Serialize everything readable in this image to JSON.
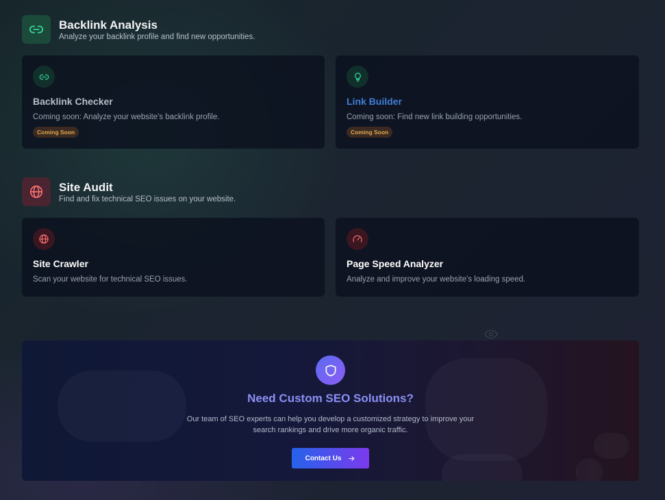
{
  "sections": [
    {
      "title": "Backlink Analysis",
      "subtitle": "Analyze your backlink profile and find new opportunities.",
      "icon": "link-icon",
      "cards": [
        {
          "title": "Backlink Checker",
          "description": "Coming soon: Analyze your website's backlink profile.",
          "badge": "Coming Soon",
          "icon": "link-icon"
        },
        {
          "title": "Link Builder",
          "description": "Coming soon: Find new link building opportunities.",
          "badge": "Coming Soon",
          "icon": "lightbulb-icon"
        }
      ]
    },
    {
      "title": "Site Audit",
      "subtitle": "Find and fix technical SEO issues on your website.",
      "icon": "globe-icon",
      "cards": [
        {
          "title": "Site Crawler",
          "description": "Scan your website for technical SEO issues.",
          "icon": "globe-icon"
        },
        {
          "title": "Page Speed Analyzer",
          "description": "Analyze and improve your website's loading speed.",
          "icon": "gauge-icon"
        }
      ]
    }
  ],
  "cta": {
    "title": "Need Custom SEO Solutions?",
    "text": "Our team of SEO experts can help you develop a customized strategy to improve your search rankings and drive more organic traffic.",
    "button_label": "Contact Us",
    "icon": "shield-icon"
  },
  "colors": {
    "green_accent": "#34d399",
    "red_accent": "#f87171",
    "badge_text": "#e0a94e",
    "link_blue": "#3f7fd8"
  }
}
